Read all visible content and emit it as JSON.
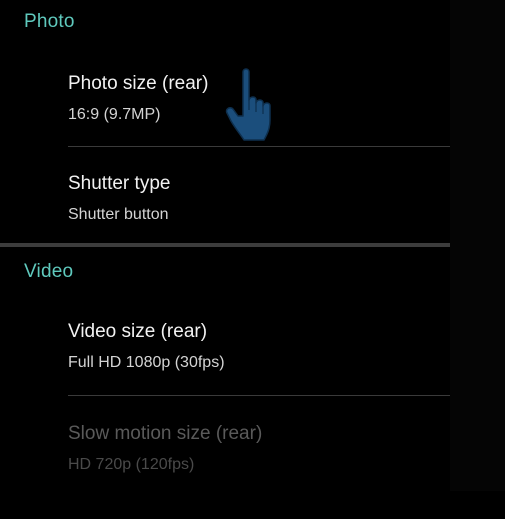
{
  "sections": [
    {
      "header": "Photo",
      "items": [
        {
          "title": "Photo size (rear)",
          "value": "16:9 (9.7MP)",
          "enabled": true
        },
        {
          "title": "Shutter type",
          "value": "Shutter button",
          "enabled": true
        }
      ]
    },
    {
      "header": "Video",
      "items": [
        {
          "title": "Video size (rear)",
          "value": "Full HD 1080p (30fps)",
          "enabled": true
        },
        {
          "title": "Slow motion size (rear)",
          "value": "HD 720p (120fps)",
          "enabled": false
        }
      ]
    }
  ],
  "colors": {
    "background": "#000000",
    "section_header": "#5fc9bd",
    "title_text": "#f2f2f2",
    "value_text": "#d4d4d4",
    "disabled_text": "#5a5a5a",
    "cursor_fill": "#1b4e7c"
  },
  "overlay": {
    "cursor_icon": "hand-pointer-icon"
  }
}
